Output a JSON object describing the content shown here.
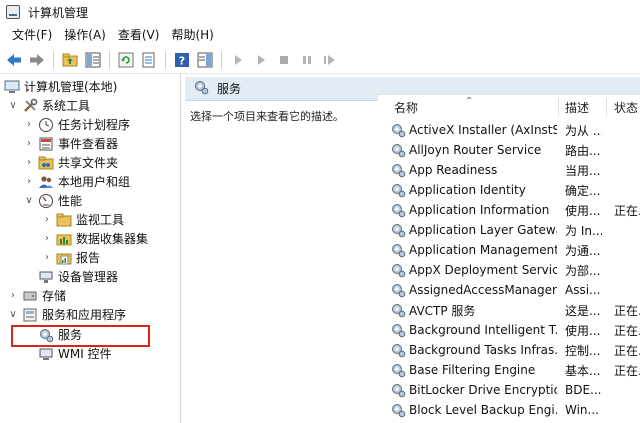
{
  "window": {
    "title": "计算机管理"
  },
  "menu": [
    "文件(F)",
    "操作(A)",
    "查看(V)",
    "帮助(H)"
  ],
  "toolbar": {
    "icons": [
      "back-arrow-icon",
      "forward-arrow-icon",
      "up-folder-icon",
      "show-hide-tree-icon",
      "refresh-icon",
      "export-list-icon",
      "help-icon",
      "show-hide-action-pane-icon",
      "start-service-icon",
      "start-service-alt-icon",
      "stop-service-icon",
      "pause-service-icon",
      "restart-service-icon"
    ]
  },
  "tree": {
    "root": "计算机管理(本地)",
    "system_tools": "系统工具",
    "task_scheduler": "任务计划程序",
    "event_viewer": "事件查看器",
    "shared_folders": "共享文件夹",
    "local_users": "本地用户和组",
    "performance": "性能",
    "monitoring_tools": "监视工具",
    "data_collector_sets": "数据收集器集",
    "reports": "报告",
    "device_manager": "设备管理器",
    "storage": "存储",
    "services_and_apps": "服务和应用程序",
    "services": "服务",
    "wmi_control": "WMI 控件"
  },
  "right": {
    "header": "服务",
    "description_prompt": "选择一个项目来查看它的描述。",
    "columns": {
      "name": "名称",
      "description": "描述",
      "status": "状态"
    },
    "services": [
      {
        "name": "ActiveX Installer (AxInstSV)",
        "desc": "为从 ...",
        "status": ""
      },
      {
        "name": "AllJoyn Router Service",
        "desc": "路由...",
        "status": ""
      },
      {
        "name": "App Readiness",
        "desc": "当用...",
        "status": ""
      },
      {
        "name": "Application Identity",
        "desc": "确定...",
        "status": ""
      },
      {
        "name": "Application Information",
        "desc": "使用...",
        "status": "正在..."
      },
      {
        "name": "Application Layer Gatewa...",
        "desc": "为 In...",
        "status": ""
      },
      {
        "name": "Application Management",
        "desc": "为通...",
        "status": ""
      },
      {
        "name": "AppX Deployment Servic...",
        "desc": "为部...",
        "status": ""
      },
      {
        "name": "AssignedAccessManager...",
        "desc": "Assi...",
        "status": ""
      },
      {
        "name": "AVCTP 服务",
        "desc": "这是...",
        "status": "正在..."
      },
      {
        "name": "Background Intelligent T...",
        "desc": "使用...",
        "status": "正在..."
      },
      {
        "name": "Background Tasks Infras...",
        "desc": "控制...",
        "status": "正在..."
      },
      {
        "name": "Base Filtering Engine",
        "desc": "基本...",
        "status": "正在..."
      },
      {
        "name": "BitLocker Drive Encryptio...",
        "desc": "BDE...",
        "status": ""
      },
      {
        "name": "Block Level Backup Engi...",
        "desc": "Win...",
        "status": ""
      }
    ]
  }
}
